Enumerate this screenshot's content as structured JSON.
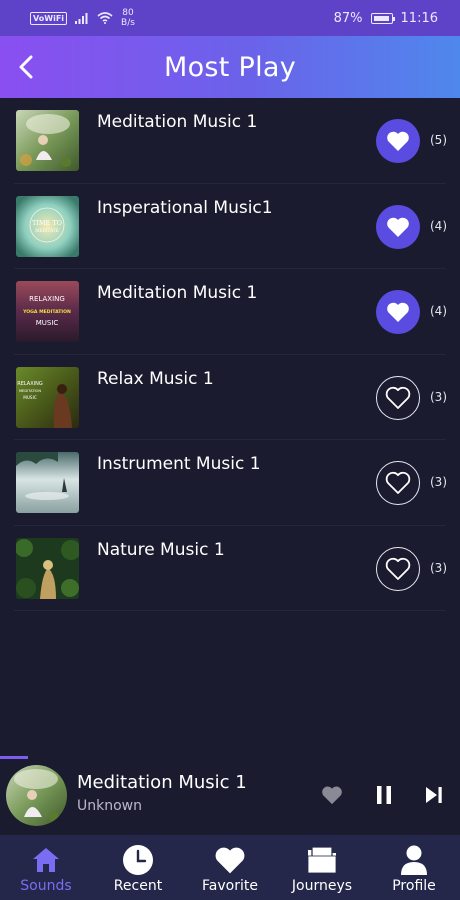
{
  "status_bar": {
    "carrier_badge": "VoWiFi",
    "net_speed_value": "80",
    "net_speed_unit": "B/s",
    "battery": "87%",
    "time": "11:16"
  },
  "header": {
    "title": "Most Play",
    "back_icon": "chevron-left-icon"
  },
  "songs": [
    {
      "title": "Meditation Music 1",
      "likes": "(5)",
      "liked": true
    },
    {
      "title": "Insperational Music1",
      "likes": "(4)",
      "liked": true
    },
    {
      "title": "Meditation Music 1",
      "likes": "(4)",
      "liked": true
    },
    {
      "title": "Relax Music 1",
      "likes": "(3)",
      "liked": false
    },
    {
      "title": "Instrument Music 1",
      "likes": "(3)",
      "liked": false
    },
    {
      "title": "Nature Music 1",
      "likes": "(3)",
      "liked": false
    }
  ],
  "thumb_text": {
    "t2_line1": "TIME TO",
    "t2_line2": "MEDITATE",
    "t3_line1": "RELAXING",
    "t3_line2": "YOGA MEDITATION",
    "t3_line3": "MUSIC",
    "t4_line1": "RELAXING",
    "t4_line2": "MEDITATION",
    "t4_line3": "MUSIC"
  },
  "mini_player": {
    "title": "Meditation Music 1",
    "artist": "Unknown",
    "progress": 0.06
  },
  "tabs": [
    {
      "label": "Sounds",
      "icon": "home-icon",
      "active": true
    },
    {
      "label": "Recent",
      "icon": "clock-icon",
      "active": false
    },
    {
      "label": "Favorite",
      "icon": "heart-icon",
      "active": false
    },
    {
      "label": "Journeys",
      "icon": "folder-icon",
      "active": false
    },
    {
      "label": "Profile",
      "icon": "person-icon",
      "active": false
    }
  ],
  "colors": {
    "accent": "#5a4ce0",
    "active_tab": "#7b6df2",
    "background": "#1a1b2e",
    "tabbar": "#24274a"
  }
}
